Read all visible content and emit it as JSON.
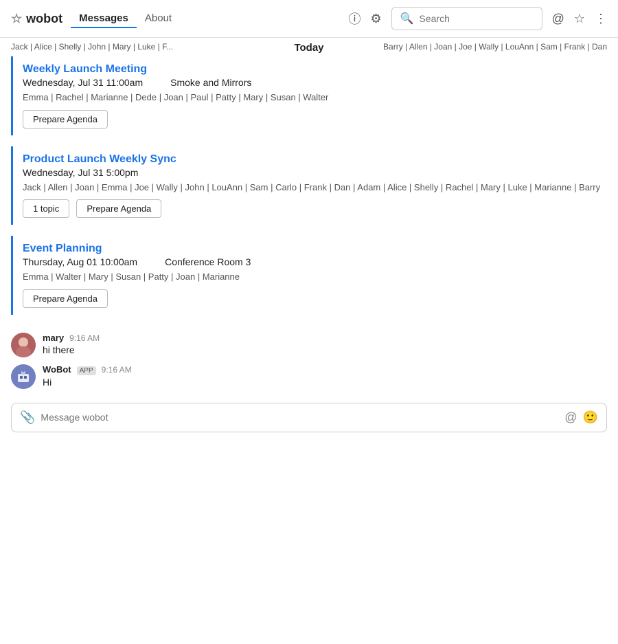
{
  "app": {
    "name": "wobot",
    "star_icon": "☆"
  },
  "nav": {
    "tabs": [
      {
        "id": "messages",
        "label": "Messages",
        "active": true
      },
      {
        "id": "about",
        "label": "About",
        "active": false
      }
    ]
  },
  "header": {
    "info_icon": "ⓘ",
    "settings_icon": "⚙",
    "search_placeholder": "Search",
    "at_icon": "@",
    "star_icon": "☆",
    "more_icon": "⋮"
  },
  "today_bar": {
    "label": "Today",
    "left_names": "Jack | Alice | Shelly | John | Mary | Luke | F...",
    "right_names": "Barry | Allen | Joan | Joe | Wally | LouAnn | Sam | Frank | Dan"
  },
  "meetings": [
    {
      "id": "weekly-launch",
      "title": "Weekly Launch Meeting",
      "datetime": "Wednesday, Jul 31 11:00am",
      "location": "Smoke and Mirrors",
      "attendees": "Emma | Rachel | Marianne | Dede | Joan | Paul | Patty | Mary | Susan | Walter",
      "actions": [
        {
          "id": "prepare-agenda-1",
          "label": "Prepare Agenda"
        }
      ]
    },
    {
      "id": "product-launch-sync",
      "title": "Product Launch Weekly Sync",
      "datetime": "Wednesday, Jul 31 5:00pm",
      "location": "",
      "attendees": "Jack | Allen | Joan | Emma | Joe | Wally | John | LouAnn | Sam | Carlo | Frank | Dan | Adam | Alice | Shelly | Rachel | Mary | Luke | Marianne | Barry",
      "actions": [
        {
          "id": "topic-btn",
          "label": "1 topic"
        },
        {
          "id": "prepare-agenda-2",
          "label": "Prepare Agenda"
        }
      ]
    },
    {
      "id": "event-planning",
      "title": "Event Planning",
      "datetime": "Thursday, Aug 01 10:00am",
      "location": "Conference Room 3",
      "attendees": "Emma | Walter | Mary | Susan | Patty | Joan | Marianne",
      "actions": [
        {
          "id": "prepare-agenda-3",
          "label": "Prepare Agenda"
        }
      ]
    }
  ],
  "messages": [
    {
      "id": "msg-mary",
      "author": "mary",
      "time": "9:16 AM",
      "text": "hi there",
      "is_bot": false,
      "avatar_emoji": "👩"
    },
    {
      "id": "msg-wobot",
      "author": "WoBot",
      "time": "9:16 AM",
      "text": "Hi",
      "is_bot": true,
      "app_badge": "APP",
      "avatar_emoji": "🤖"
    }
  ],
  "input": {
    "placeholder": "Message wobot",
    "at_icon": "@",
    "emoji_icon": "🙂",
    "attach_icon": "📎"
  }
}
